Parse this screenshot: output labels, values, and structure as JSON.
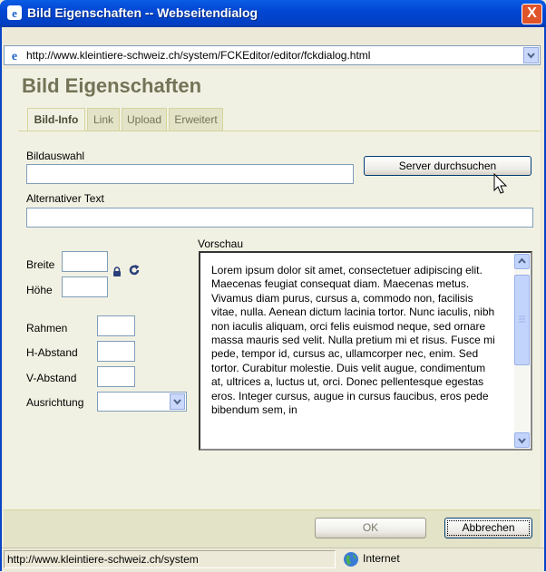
{
  "window": {
    "title": "Bild Eigenschaften -- Webseitendialog",
    "close_label": "X"
  },
  "address": {
    "url": "http://www.kleintiere-schweiz.ch/system/FCKEditor/editor/fckdialog.html"
  },
  "dialog": {
    "heading": "Bild Eigenschaften",
    "tabs": [
      {
        "label": "Bild-Info",
        "active": true
      },
      {
        "label": "Link",
        "active": false
      },
      {
        "label": "Upload",
        "active": false
      },
      {
        "label": "Erweitert",
        "active": false
      }
    ],
    "image_select_label": "Bildauswahl",
    "image_select_value": "",
    "browse_button": "Server durchsuchen",
    "alt_text_label": "Alternativer Text",
    "alt_text_value": "",
    "width_label": "Breite",
    "height_label": "Höhe",
    "border_label": "Rahmen",
    "hspace_label": "H-Abstand",
    "vspace_label": "V-Abstand",
    "align_label": "Ausrichtung",
    "align_value": "",
    "preview_label": "Vorschau",
    "preview_text": "Lorem ipsum dolor sit amet, consectetuer adipiscing elit. Maecenas feugiat consequat diam. Maecenas metus. Vivamus diam purus, cursus a, commodo non, facilisis vitae, nulla. Aenean dictum lacinia tortor. Nunc iaculis, nibh non iaculis aliquam, orci felis euismod neque, sed ornare massa mauris sed velit. Nulla pretium mi et risus. Fusce mi pede, tempor id, cursus ac, ullamcorper nec, enim. Sed tortor. Curabitur molestie. Duis velit augue, condimentum at, ultrices a, luctus ut, orci. Donec pellentesque egestas eros. Integer cursus, augue in cursus faucibus, eros pede bibendum sem, in"
  },
  "footer": {
    "ok_label": "OK",
    "cancel_label": "Abbrechen"
  },
  "status": {
    "url_text": "http://www.kleintiere-schweiz.ch/system",
    "zone": "Internet"
  },
  "colors": {
    "titlebar": "#0246d3",
    "dialog_bg": "#f1f1e3",
    "heading": "#737357"
  }
}
